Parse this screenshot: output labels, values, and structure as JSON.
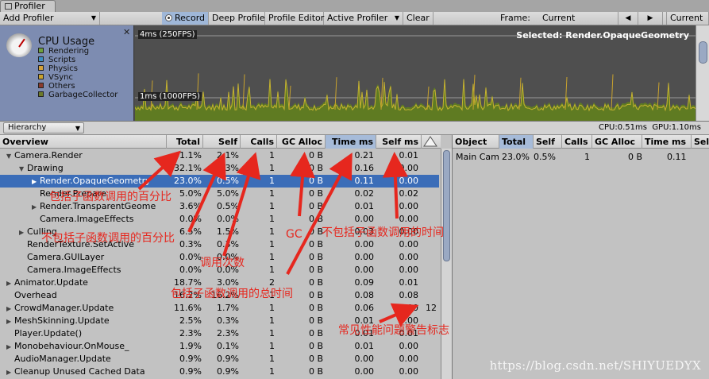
{
  "window": {
    "tab_title": "Profiler"
  },
  "toolbar": {
    "add_profiler": "Add Profiler",
    "record": "Record",
    "deep_profile": "Deep Profile",
    "profile_editor": "Profile Editor",
    "active_profiler": "Active Profiler",
    "clear": "Clear",
    "frame_label": "Frame:",
    "frame_value": "Current",
    "prev_glyph": "◀",
    "next_glyph": "▶",
    "current_button": "Current"
  },
  "cpu_panel": {
    "title": "CPU Usage",
    "close_glyph": "✕",
    "legend": [
      {
        "label": "Rendering",
        "color": "#6fa13d"
      },
      {
        "label": "Scripts",
        "color": "#3b8fc4"
      },
      {
        "label": "Physics",
        "color": "#d4a23b"
      },
      {
        "label": "VSync",
        "color": "#c8a22e"
      },
      {
        "label": "Others",
        "color": "#8a3b2e"
      },
      {
        "label": "GarbageCollector",
        "color": "#6c7a2a"
      }
    ]
  },
  "graph": {
    "line_top_label": "4ms (250FPS)",
    "line_bottom_label": "1ms (1000FPS)",
    "selected_label": "Selected: Render.OpaqueGeometry"
  },
  "sub_toolbar": {
    "view_mode": "Hierarchy",
    "cpu_time": "CPU:0.51ms",
    "gpu_time": "GPU:1.10ms"
  },
  "hierarchy": {
    "columns": [
      "Overview",
      "Total",
      "Self",
      "Calls",
      "GC Alloc",
      "Time ms",
      "Self ms"
    ],
    "rows": [
      {
        "indent": 0,
        "arrow": "▼",
        "name": "Camera.Render",
        "total": "41.1%",
        "self": "2.1%",
        "calls": "1",
        "gc": "0 B",
        "time": "0.21",
        "selfms": "0.01",
        "warn": ""
      },
      {
        "indent": 1,
        "arrow": "▼",
        "name": "Drawing",
        "total": "32.1%",
        "self": "0.3%",
        "calls": "1",
        "gc": "0 B",
        "time": "0.16",
        "selfms": "0.00",
        "warn": ""
      },
      {
        "indent": 2,
        "arrow": "▶",
        "name": "Render.OpaqueGeometry",
        "total": "23.0%",
        "self": "0.5%",
        "calls": "1",
        "gc": "0 B",
        "time": "0.11",
        "selfms": "0.00",
        "warn": "",
        "selected": true
      },
      {
        "indent": 2,
        "arrow": "",
        "name": "Render.Prepare",
        "total": "5.0%",
        "self": "5.0%",
        "calls": "1",
        "gc": "0 B",
        "time": "0.02",
        "selfms": "0.02",
        "warn": ""
      },
      {
        "indent": 2,
        "arrow": "▶",
        "name": "Render.TransparentGeome",
        "total": "3.6%",
        "self": "0.5%",
        "calls": "1",
        "gc": "0 B",
        "time": "0.01",
        "selfms": "0.00",
        "warn": ""
      },
      {
        "indent": 2,
        "arrow": "",
        "name": "Camera.ImageEffects",
        "total": "0.0%",
        "self": "0.0%",
        "calls": "1",
        "gc": "0 B",
        "time": "0.00",
        "selfms": "0.00",
        "warn": ""
      },
      {
        "indent": 1,
        "arrow": "▶",
        "name": "Culling",
        "total": "6.5%",
        "self": "1.5%",
        "calls": "1",
        "gc": "0 B",
        "time": "0.03",
        "selfms": "0.00",
        "warn": ""
      },
      {
        "indent": 1,
        "arrow": "",
        "name": "RenderTexture.SetActive",
        "total": "0.3%",
        "self": "0.3%",
        "calls": "1",
        "gc": "0 B",
        "time": "0.00",
        "selfms": "0.00",
        "warn": ""
      },
      {
        "indent": 1,
        "arrow": "",
        "name": "Camera.GUILayer",
        "total": "0.0%",
        "self": "0.0%",
        "calls": "1",
        "gc": "0 B",
        "time": "0.00",
        "selfms": "0.00",
        "warn": ""
      },
      {
        "indent": 1,
        "arrow": "",
        "name": "Camera.ImageEffects",
        "total": "0.0%",
        "self": "0.0%",
        "calls": "1",
        "gc": "0 B",
        "time": "0.00",
        "selfms": "0.00",
        "warn": ""
      },
      {
        "indent": 0,
        "arrow": "▶",
        "name": "Animator.Update",
        "total": "18.7%",
        "self": "3.0%",
        "calls": "2",
        "gc": "0 B",
        "time": "0.09",
        "selfms": "0.01",
        "warn": ""
      },
      {
        "indent": 0,
        "arrow": "",
        "name": "Overhead",
        "total": "16.2%",
        "self": "16.2%",
        "calls": "1",
        "gc": "0 B",
        "time": "0.08",
        "selfms": "0.08",
        "warn": ""
      },
      {
        "indent": 0,
        "arrow": "▶",
        "name": "CrowdManager.Update",
        "total": "11.6%",
        "self": "1.7%",
        "calls": "1",
        "gc": "0 B",
        "time": "0.06",
        "selfms": "0.00",
        "warn": "12"
      },
      {
        "indent": 0,
        "arrow": "▶",
        "name": "MeshSkinning.Update",
        "total": "2.5%",
        "self": "0.3%",
        "calls": "1",
        "gc": "0 B",
        "time": "0.01",
        "selfms": "0.00",
        "warn": ""
      },
      {
        "indent": 0,
        "arrow": "",
        "name": "Player.Update()",
        "total": "2.3%",
        "self": "2.3%",
        "calls": "1",
        "gc": "0 B",
        "time": "0.01",
        "selfms": "0.01",
        "warn": ""
      },
      {
        "indent": 0,
        "arrow": "▶",
        "name": "Monobehaviour.OnMouse_",
        "total": "1.9%",
        "self": "0.1%",
        "calls": "1",
        "gc": "0 B",
        "time": "0.01",
        "selfms": "0.00",
        "warn": ""
      },
      {
        "indent": 0,
        "arrow": "",
        "name": "AudioManager.Update",
        "total": "0.9%",
        "self": "0.9%",
        "calls": "1",
        "gc": "0 B",
        "time": "0.00",
        "selfms": "0.00",
        "warn": ""
      },
      {
        "indent": 0,
        "arrow": "▶",
        "name": "Cleanup Unused Cached Data",
        "total": "0.9%",
        "self": "0.9%",
        "calls": "1",
        "gc": "0 B",
        "time": "0.00",
        "selfms": "0.00",
        "warn": ""
      }
    ]
  },
  "objects": {
    "columns": [
      "Object",
      "Total",
      "Self",
      "Calls",
      "GC Alloc",
      "Time ms",
      "Sel"
    ],
    "row": {
      "object": "Main Cam",
      "total": "23.0%",
      "self": "0.5%",
      "calls": "1",
      "gc": "0 B",
      "time": "0.11"
    }
  },
  "annotations": {
    "total_note": "包括子函数调用的百分比",
    "self_note": "不包括子函数调用的百分比",
    "calls_note": "调用次数",
    "total_time_note": "包括子函数调用的总时间",
    "gc_note": "GC",
    "self_time_note": "不包括子函数调用的时间",
    "warning_note": "常见性能问题警告标志"
  },
  "watermark": "https://blog.csdn.net/SHIYUEDYX"
}
